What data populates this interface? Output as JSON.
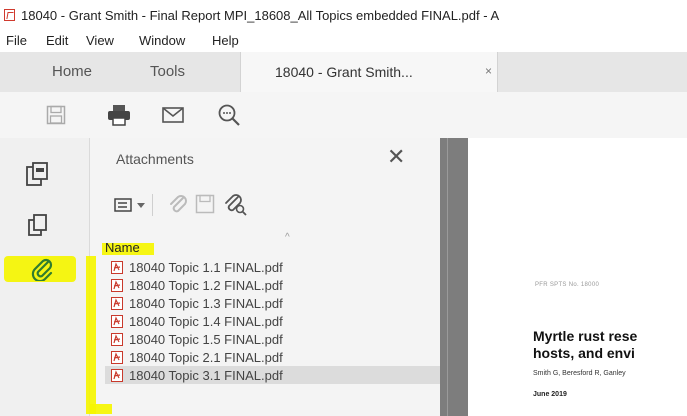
{
  "window": {
    "title": "18040 - Grant Smith - Final Report MPI_18608_All Topics embedded FINAL.pdf - A"
  },
  "menu": [
    "File",
    "Edit",
    "View",
    "Window",
    "Help"
  ],
  "tabs": {
    "home": "Home",
    "tools": "Tools",
    "document": "18040 - Grant Smith...",
    "document_close": "×"
  },
  "toolbar": {
    "icons": [
      "save-icon",
      "print-icon",
      "email-icon",
      "find-icon"
    ]
  },
  "rail": {
    "icons": [
      "page-thumbnails-icon",
      "copy-pages-icon",
      "attachments-paperclip-icon"
    ]
  },
  "attachments": {
    "title": "Attachments",
    "close": "✕",
    "column_name": "Name",
    "sort_indicator": "^",
    "files": [
      "18040 Topic 1.1 FINAL.pdf",
      "18040 Topic 1.2 FINAL.pdf",
      "18040 Topic 1.3 FINAL.pdf",
      "18040 Topic 1.4 FINAL.pdf",
      "18040 Topic 1.5 FINAL.pdf",
      "18040 Topic 2.1 FINAL.pdf",
      "18040 Topic 3.1 FINAL.pdf"
    ]
  },
  "document": {
    "report_number": "PFR SPTS No. 18000",
    "heading_line1": "Myrtle rust rese",
    "heading_line2": "hosts, and envi",
    "authors": "Smith G, Beresford R, Ganley",
    "date": "June 2019"
  },
  "annotation": {
    "highlight_color": "#f5f500"
  }
}
